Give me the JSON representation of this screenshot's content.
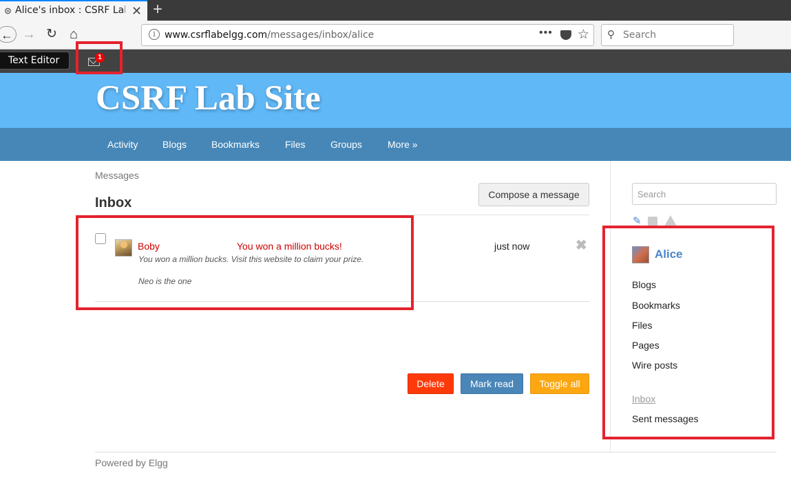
{
  "browser": {
    "tab_title": "Alice's inbox : CSRF Lab Site",
    "tab_close": "✕",
    "new_tab": "+",
    "url_host": "www.csrflabelgg.com",
    "url_path": "/messages/inbox/alice",
    "url_menu": "•••",
    "search_placeholder": "Search"
  },
  "topbar": {
    "text_editor_tooltip": "Text Editor",
    "mail_badge": "1"
  },
  "site": {
    "title": "CSRF Lab Site",
    "nav": [
      "Activity",
      "Blogs",
      "Bookmarks",
      "Files",
      "Groups",
      "More »"
    ]
  },
  "main": {
    "breadcrumb": "Messages",
    "title": "Inbox",
    "compose_label": "Compose a message",
    "message": {
      "from": "Boby",
      "subject": "You won a million bucks!",
      "time": "just now",
      "body_line1": "You won a million bucks. Visit this website to claim your prize.",
      "body_line2": "Neo is the one",
      "delete_glyph": "✖"
    },
    "buttons": {
      "delete": "Delete",
      "mark_read": "Mark read",
      "toggle_all": "Toggle all"
    }
  },
  "sidebar": {
    "search_placeholder": "Search",
    "user": "Alice",
    "links": [
      "Blogs",
      "Bookmarks",
      "Files",
      "Pages",
      "Wire posts"
    ],
    "inbox": "Inbox",
    "sent": "Sent messages"
  },
  "footer": {
    "text": "Powered by Elgg"
  },
  "colors": {
    "header_bg": "#60b8f7",
    "nav_bg": "#4687b8",
    "annotation": "#e3232f",
    "delete_btn": "#ff3a0a",
    "markread_btn": "#4a86b8",
    "toggle_btn": "#fca712"
  }
}
